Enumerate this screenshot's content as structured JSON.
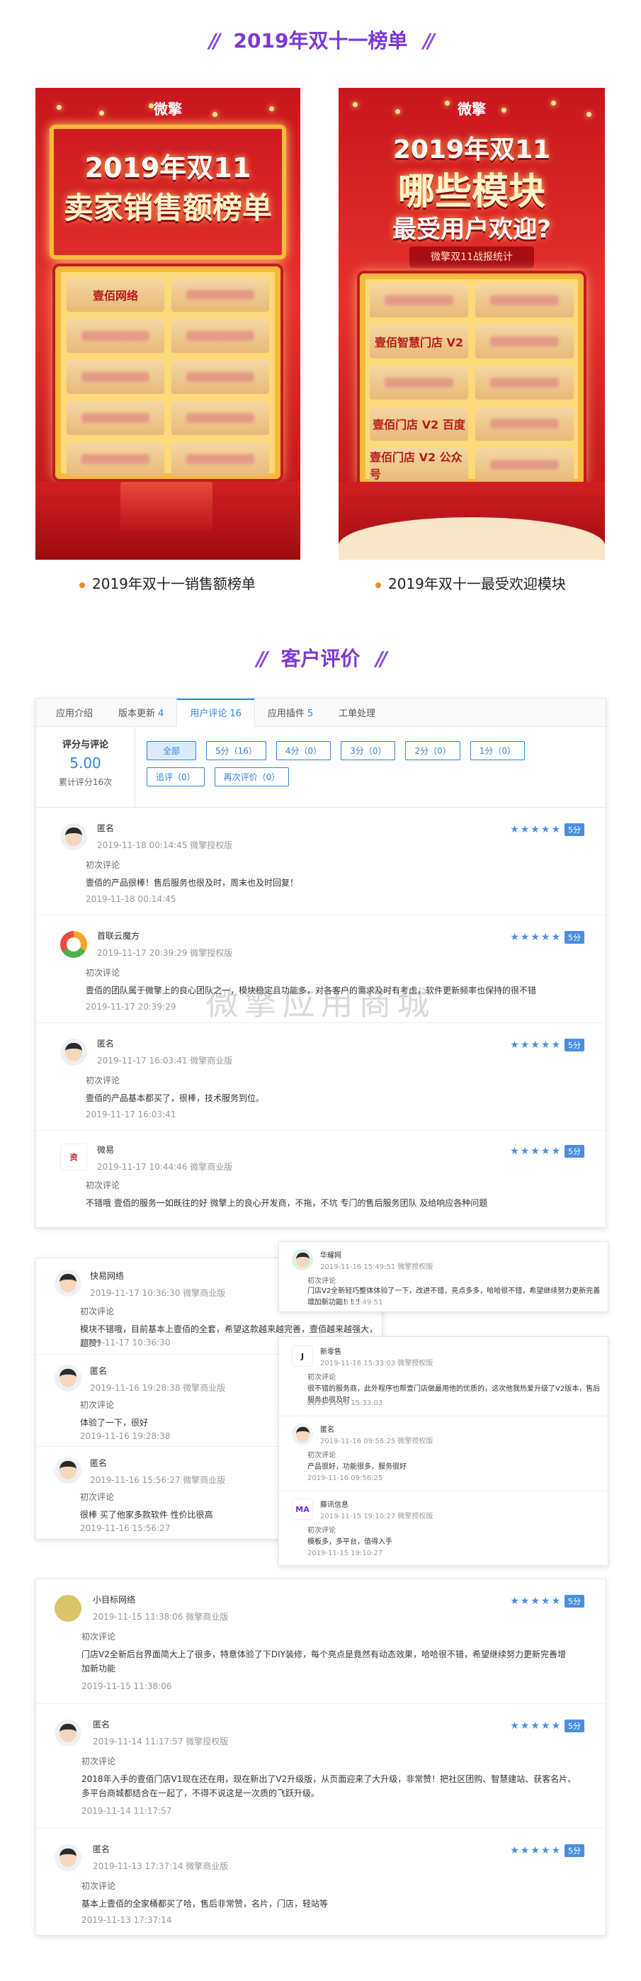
{
  "section1": {
    "title": "2019年双十一榜单"
  },
  "poster_left": {
    "brand": "微擎",
    "headline_line1": "2019年双11",
    "headline_line2": "卖家销售额榜单",
    "first_cell": "壹佰网络",
    "caption": "2019年双十一销售额榜单"
  },
  "poster_right": {
    "brand": "微擎",
    "headline_line1": "2019年双11",
    "headline_line2": "哪些模块",
    "headline_line3": "最受用户欢迎?",
    "ribbon": "微擎双11战报统计",
    "cells": [
      "壹佰智慧门店 V2",
      "壹佰门店 V2 百度",
      "壹佰门店 V2 公众号"
    ],
    "caption": "2019年双十一最受欢迎模块"
  },
  "section2": {
    "title": "客户评价"
  },
  "panel1": {
    "tabs": [
      {
        "label": "应用介绍",
        "count": ""
      },
      {
        "label": "版本更新",
        "count": "4"
      },
      {
        "label": "用户评论",
        "count": "16"
      },
      {
        "label": "应用插件",
        "count": "5"
      },
      {
        "label": "工单处理",
        "count": ""
      }
    ],
    "summary": {
      "title": "评分与评论",
      "score": "5.00",
      "total": "累计评分16次"
    },
    "filters": [
      "全部",
      "5分（16）",
      "4分（0）",
      "3分（0）",
      "2分（0）",
      "1分（0）",
      "追评（0）",
      "再次评价（0）"
    ],
    "reviews": [
      {
        "user": "匿名",
        "meta": "2019-11-18 00:14:45 微擎授权版",
        "kind": "初次评论",
        "text": "壹佰的产品很棒！售后服务也很及时，周末也及时回复！",
        "time": "2019-11-18 00:14:45",
        "stars": "★★★★★",
        "badge": "5分"
      },
      {
        "user": "首联云魔方",
        "meta": "2019-11-17 20:39:29 微擎授权版",
        "kind": "初次评论",
        "text": "壹佰的团队属于微擎上的良心团队之一，模块稳定且功能多，对各客户的需求及时有考虑，软件更新频率也保持的很不错",
        "time": "2019-11-17 20:39:29",
        "stars": "★★★★★",
        "badge": "5分"
      },
      {
        "user": "匿名",
        "meta": "2019-11-17 16:03:41 微擎商业版",
        "kind": "初次评论",
        "text": "壹佰的产品基本都买了，很棒，技术服务到位。",
        "time": "2019-11-17 16:03:41",
        "stars": "★★★★★",
        "badge": "5分"
      },
      {
        "user": "微易",
        "meta": "2019-11-17 10:44:46 微擎商业版",
        "kind": "初次评论",
        "text": "不错哦 壹佰的服务一如既往的好 微擎上的良心开发商，不拖，不坑 专门的售后服务团队 及给响应各种问题",
        "time": "",
        "stars": "★★★★★",
        "badge": "5分"
      }
    ]
  },
  "panel2": {
    "reviews": [
      {
        "user": "快易网络",
        "meta": "2019-11-17 10:36:30 微擎商业版",
        "kind": "初次评论",
        "text": "模块不错哦，目前基本上壹佰的全套，希望这款越来越完善，壹佰越来越强大，超赞！",
        "time": "2019-11-17 10:36:30"
      },
      {
        "user": "匿名",
        "meta": "2019-11-16 19:28:38 微擎商业版",
        "kind": "初次评论",
        "text": "体验了一下，很好",
        "time": "2019-11-16 19:28:38"
      },
      {
        "user": "匿名",
        "meta": "2019-11-16 15:56:27 微擎商业版",
        "kind": "初次评论",
        "text": "很棒 买了他家多款软件 性价比很高",
        "time": "2019-11-16 15:56:27"
      }
    ]
  },
  "panel3": {
    "reviews": [
      {
        "user": "华耀网",
        "meta": "2019-11-16 15:49:51 微擎授权版",
        "kind": "初次评论",
        "text": "门店V2全新轻巧整体体验了一下，改进不错，亮点多多，哈哈很不错，希望继续努力更新完善增加新功能！！！",
        "time": "2019-11-16 15:49:51"
      }
    ]
  },
  "panel4": {
    "reviews": [
      {
        "user": "新零售",
        "meta": "2019-11-16 15:33:03 微擎授权版",
        "kind": "初次评论",
        "text": "很不错的服务商，此外程序也帮壹门店做最用他的优质的，这次他我热爱升级了V2版本，售后服务也很及时",
        "time": "2019-11-16 15:33:03"
      },
      {
        "user": "匿名",
        "meta": "2019-11-16 09:56:25 微擎授权版",
        "kind": "初次评论",
        "text": "产品很好，功能很多，服务很好",
        "time": "2019-11-16 09:56:25"
      },
      {
        "user": "藤讯信息",
        "meta": "2019-11-15 19:10:27 微擎授权版",
        "kind": "初次评论",
        "text": "模板多，多平台，值得入手",
        "time": "2019-11-15 19:10:27"
      }
    ]
  },
  "panel5": {
    "reviews": [
      {
        "user": "小目标网络",
        "meta": "2019-11-15 11:38:06 微擎商业版",
        "kind": "初次评论",
        "text": "门店V2全新后台界面简大上了很多，特意体验了下DIY装修，每个亮点是竟然有动态效果，哈哈很不错，希望继续努力更新完善增加新功能",
        "time": "2019-11-15 11:38:06",
        "stars": "★★★★★",
        "badge": "5分"
      },
      {
        "user": "匿名",
        "meta": "2019-11-14 11:17:57 微擎授权版",
        "kind": "初次评论",
        "text": "2018年入手的壹佰门店V1现在还在用，现在新出了V2升级版，从页面迎来了大升级，非常赞！把社区团购、智慧建站、获客名片、多平台商城都结合在一起了，不得不说这是一次质的飞跃升级。",
        "time": "2019-11-14 11:17:57",
        "stars": "★★★★★",
        "badge": "5分"
      },
      {
        "user": "匿名",
        "meta": "2019-11-13 17:37:14 微擎商业版",
        "kind": "初次评论",
        "text": "基本上壹佰的全家桶都买了哈，售后非常赞，名片，门店，轻站等",
        "time": "2019-11-13 17:37:14",
        "stars": "★★★★★",
        "badge": "5分"
      }
    ]
  },
  "watermark": "微擎应用商城"
}
